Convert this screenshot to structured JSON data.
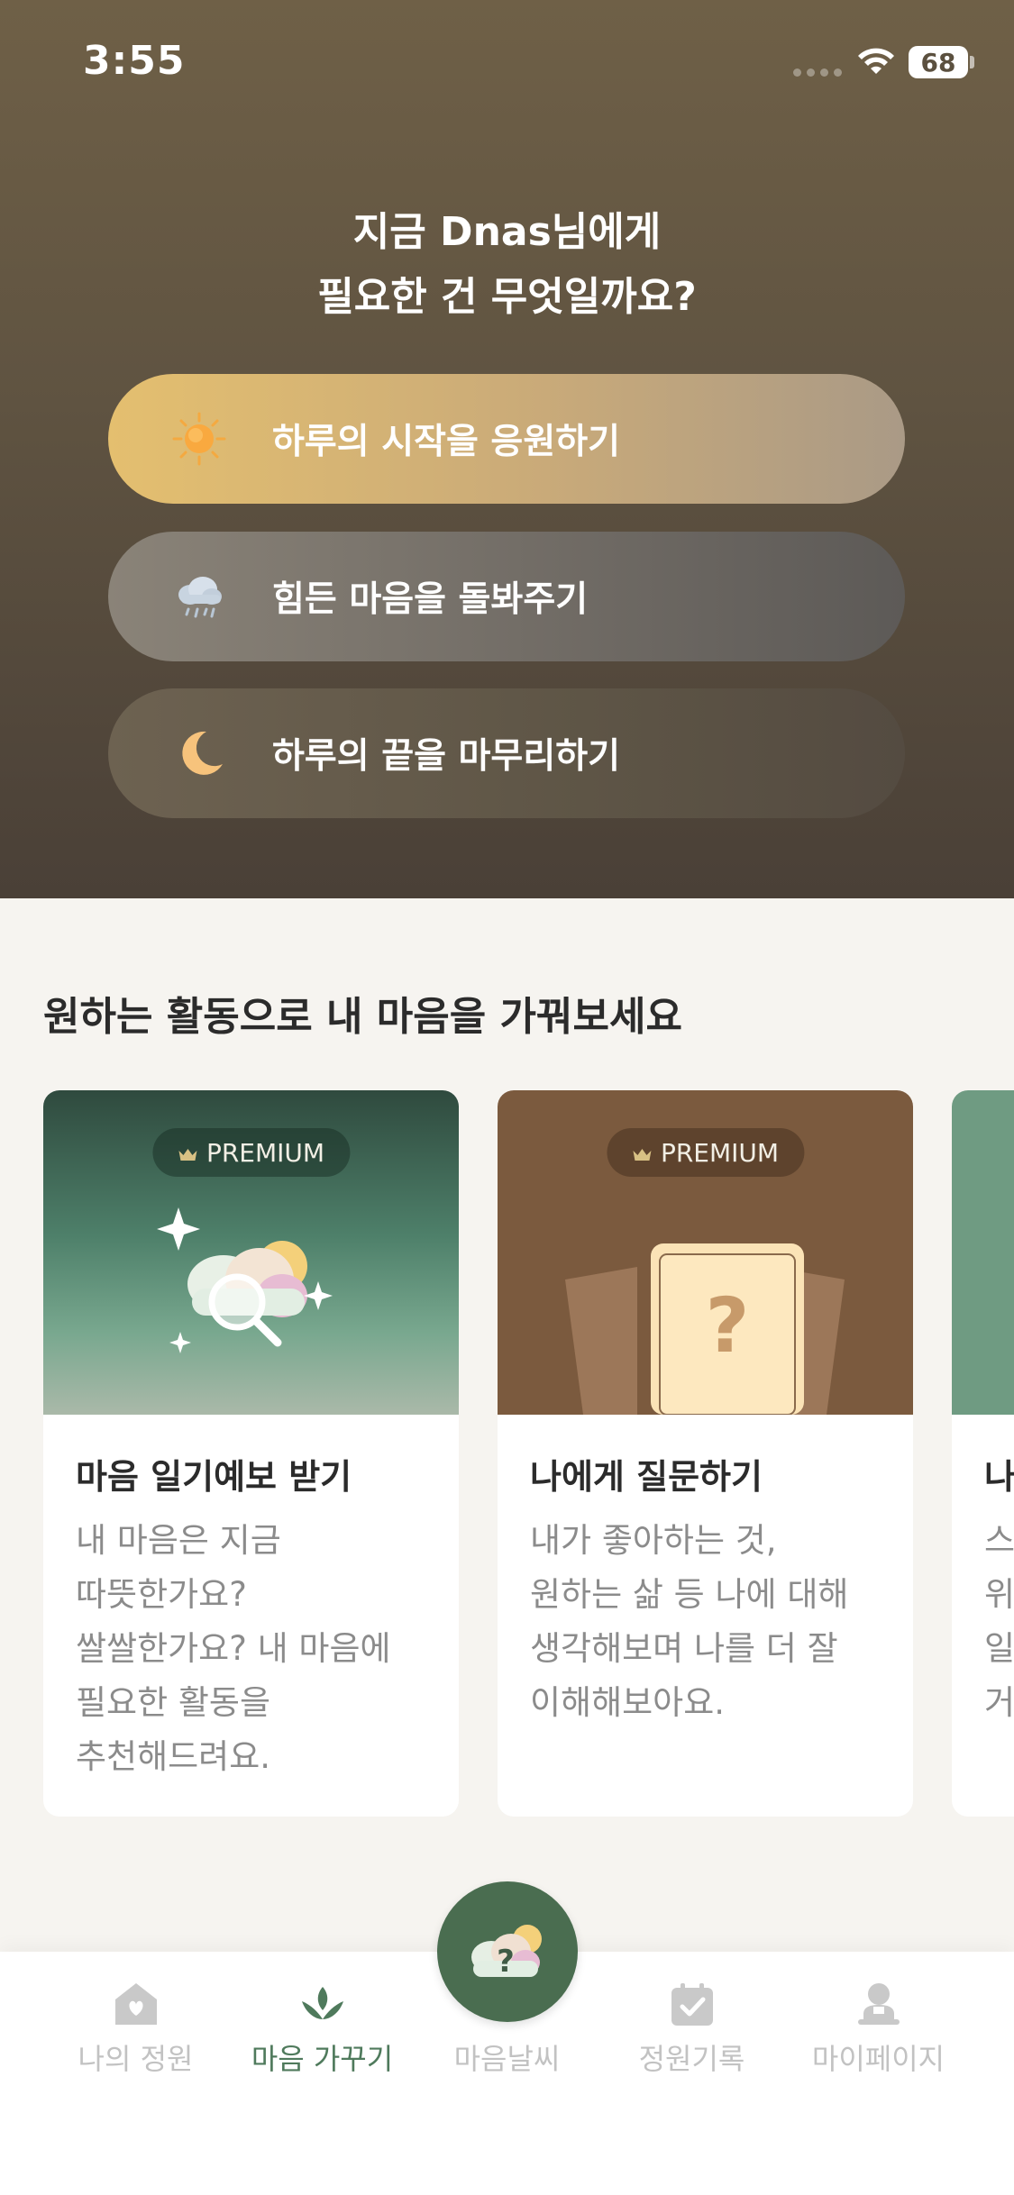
{
  "status_bar": {
    "time": "3:55",
    "battery": "68"
  },
  "hero": {
    "title_line1": "지금 Dnas님에게",
    "title_line2": "필요한 건 무엇일까요?",
    "options": [
      {
        "label": "하루의 시작을 응원하기",
        "icon": "sun-icon"
      },
      {
        "label": "힘든 마음을 돌봐주기",
        "icon": "rain-cloud-icon"
      },
      {
        "label": "하루의 끝을 마무리하기",
        "icon": "moon-icon"
      }
    ]
  },
  "activities": {
    "title": "원하는 활동으로 내 마음을 가꿔보세요",
    "cards": [
      {
        "badge": "PREMIUM",
        "title": "마음 일기예보 받기",
        "desc_lines": [
          "내 마음은 지금",
          "따뜻한가요?",
          "쌀쌀한가요? 내 마음에",
          "필요한 활동을",
          "추천해드려요."
        ]
      },
      {
        "badge": "PREMIUM",
        "title": "나에게 질문하기",
        "desc_lines": [
          "내가 좋아하는 것,",
          "원하는 삶 등 나에 대해",
          "생각해보며 나를 더 잘",
          "이해해보아요."
        ]
      },
      {
        "title": "나",
        "desc_lines": [
          "스",
          "위",
          "일",
          "거"
        ]
      }
    ]
  },
  "tabbar": {
    "items": [
      {
        "label": "나의 정원",
        "icon": "garden-icon"
      },
      {
        "label": "마음 가꾸기",
        "icon": "sprout-icon",
        "active": true
      },
      {
        "label": "마음날씨",
        "icon": "weather-icon"
      },
      {
        "label": "정원기록",
        "icon": "calendar-check-icon"
      },
      {
        "label": "마이페이지",
        "icon": "person-icon"
      }
    ]
  },
  "colors": {
    "accent": "#4f7a5c",
    "center_button": "#4a6d50"
  }
}
